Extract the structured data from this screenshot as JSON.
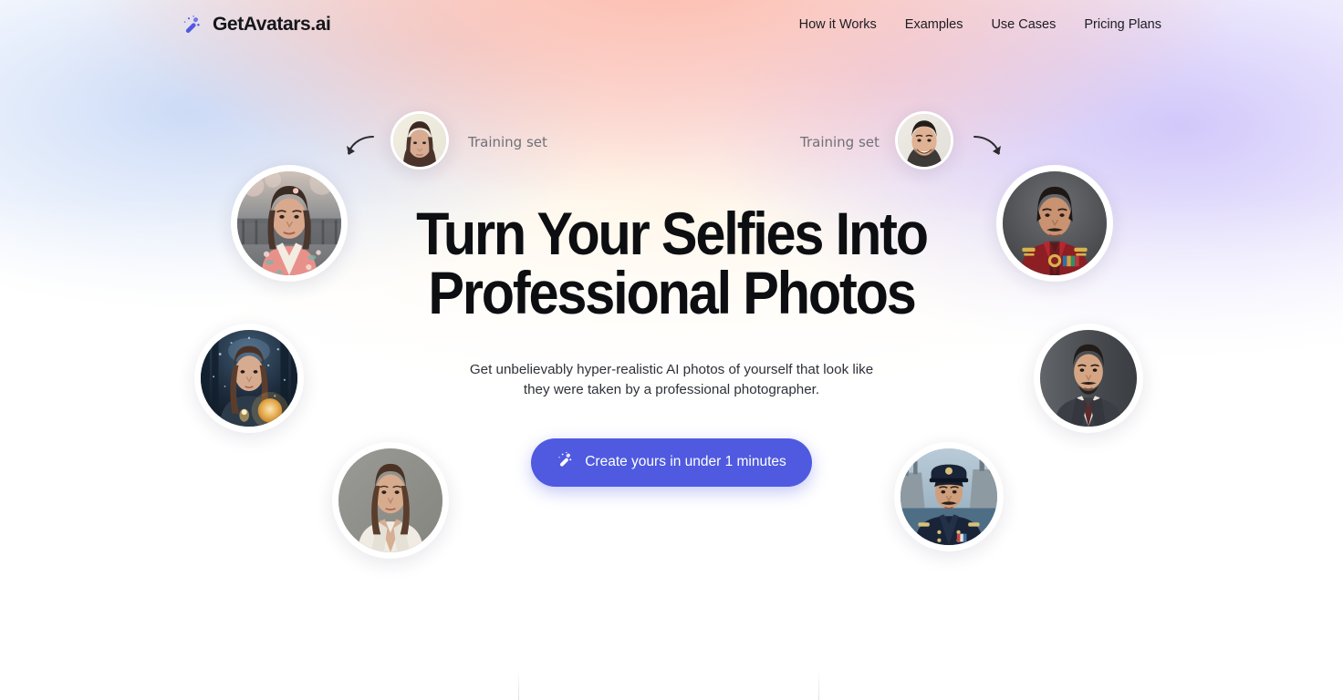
{
  "brand": {
    "name": "GetAvatars.ai",
    "icon": "magic-wand-icon",
    "accent": "#4f5ae0"
  },
  "nav": {
    "items": [
      {
        "label": "How it Works"
      },
      {
        "label": "Examples"
      },
      {
        "label": "Use Cases"
      },
      {
        "label": "Pricing Plans"
      }
    ]
  },
  "hero": {
    "headline_line1": "Turn Your Selfies Into",
    "headline_line2": "Professional Photos",
    "subtitle": "Get unbelievably hyper-realistic AI photos of yourself that look like they were taken by a professional photographer.",
    "cta": {
      "label": "Create yours in under 1 minutes",
      "icon": "magic-wand-icon",
      "background": "#4f5ae0",
      "text_color": "#ffffff"
    }
  },
  "annotations": {
    "training_set_left": "Training set",
    "training_set_right": "Training set",
    "arrow_left": "curved-arrow-down-left-icon",
    "arrow_right": "curved-arrow-down-right-icon"
  },
  "avatars": [
    {
      "name": "avatar-training-left",
      "kind": "selfie",
      "description": "Selfie of woman with long dark hair on pale background"
    },
    {
      "name": "avatar-training-right",
      "kind": "selfie",
      "description": "Selfie of smiling man with short dark hair"
    },
    {
      "name": "avatar-kimono",
      "kind": "generated",
      "description": "Woman in pink floral kimono outdoors"
    },
    {
      "name": "avatar-military-red",
      "kind": "generated",
      "description": "Man in red ceremonial military uniform with medals"
    },
    {
      "name": "avatar-fantasy",
      "kind": "generated",
      "description": "Woman in dark fantasy forest holding glowing orb"
    },
    {
      "name": "avatar-business-suit",
      "kind": "generated",
      "description": "Man in grey suit and dark red tie, studio backdrop"
    },
    {
      "name": "avatar-white-blazer",
      "kind": "generated",
      "description": "Woman in white blazer, grey studio backdrop"
    },
    {
      "name": "avatar-naval-officer",
      "kind": "generated",
      "description": "Man in navy officer uniform and cap by warships"
    }
  ],
  "footer_hint": {
    "divider_count": 2
  }
}
